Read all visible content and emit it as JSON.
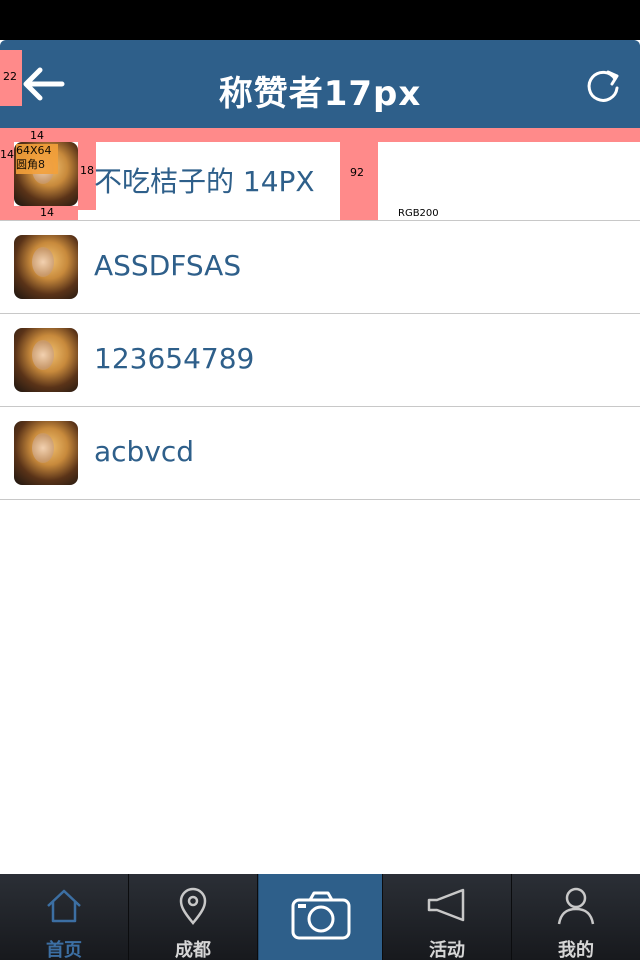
{
  "header": {
    "title": "称赞者17px"
  },
  "annotations": {
    "left_margin": "22",
    "top_gap": "14",
    "left_gap": "14",
    "avatar_spec": "64X64\n圆角8",
    "avatar_spec_line1": "64X64",
    "avatar_spec_line2": "圆角8",
    "name_gap": "18",
    "bottom_gap": "14",
    "row_height": "92",
    "divider_color": "RGB200"
  },
  "list": {
    "items": [
      {
        "name": "不吃桔子的  14PX"
      },
      {
        "name": "ASSDFSAS"
      },
      {
        "name": "123654789"
      },
      {
        "name": "acbvcd"
      }
    ]
  },
  "tabbar": {
    "tabs": [
      {
        "label": "首页",
        "icon": "home-icon",
        "active": true
      },
      {
        "label": "成都",
        "icon": "location-pin-icon",
        "active": false
      },
      {
        "label": "",
        "icon": "camera-icon",
        "active": false
      },
      {
        "label": "活动",
        "icon": "megaphone-icon",
        "active": false
      },
      {
        "label": "我的",
        "icon": "user-icon",
        "active": false
      }
    ]
  },
  "colors": {
    "header": "#2e5f8a",
    "text_blue": "#2e5f8a",
    "annotation": "#ff8a8a",
    "tab_active": "#3c6fa3"
  }
}
